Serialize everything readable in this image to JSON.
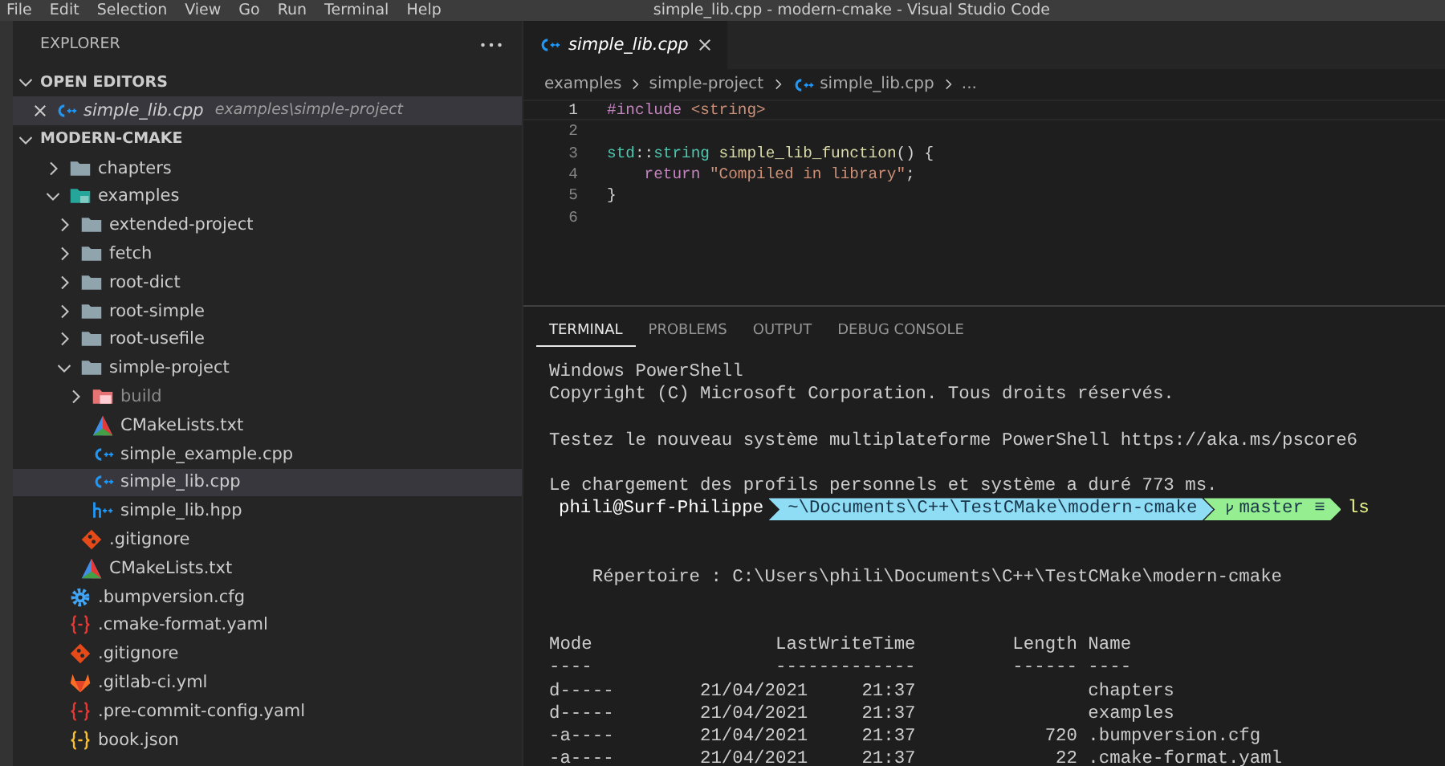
{
  "menu": [
    "File",
    "Edit",
    "Selection",
    "View",
    "Go",
    "Run",
    "Terminal",
    "Help"
  ],
  "window": {
    "title": "simple_lib.cpp - modern-cmake - Visual Studio Code"
  },
  "explorer": {
    "title": "EXPLORER"
  },
  "open_editors": {
    "title": "OPEN EDITORS",
    "expanded": true,
    "items": [
      {
        "name": "simple_lib.cpp",
        "path": "examples\\simple-project",
        "kind": "cpp",
        "selected": true
      }
    ]
  },
  "project": {
    "title": "MODERN-CMAKE",
    "expanded": true,
    "tree": [
      {
        "name": "chapters",
        "kind": "folder",
        "expanded": false,
        "selected": false,
        "dimmed": false
      },
      {
        "name": "examples",
        "kind": "examples",
        "expanded": true,
        "selected": false,
        "dimmed": false,
        "children": [
          {
            "name": "extended-project",
            "kind": "folder",
            "expanded": false,
            "selected": false,
            "dimmed": false
          },
          {
            "name": "fetch",
            "kind": "folder",
            "expanded": false,
            "selected": false,
            "dimmed": false
          },
          {
            "name": "root-dict",
            "kind": "folder",
            "expanded": false,
            "selected": false,
            "dimmed": false
          },
          {
            "name": "root-simple",
            "kind": "folder",
            "expanded": false,
            "selected": false,
            "dimmed": false
          },
          {
            "name": "root-usefile",
            "kind": "folder",
            "expanded": false,
            "selected": false,
            "dimmed": false
          },
          {
            "name": "simple-project",
            "kind": "folder",
            "expanded": true,
            "selected": false,
            "dimmed": false,
            "children": [
              {
                "name": "build",
                "kind": "build",
                "expanded": false,
                "selected": false,
                "dimmed": true
              },
              {
                "name": "CMakeLists.txt",
                "kind": "cmake",
                "selected": false,
                "dimmed": false
              },
              {
                "name": "simple_example.cpp",
                "kind": "cpp",
                "selected": false,
                "dimmed": false
              },
              {
                "name": "simple_lib.cpp",
                "kind": "cpp",
                "selected": true,
                "dimmed": false
              },
              {
                "name": "simple_lib.hpp",
                "kind": "hpp",
                "selected": false,
                "dimmed": false
              }
            ]
          },
          {
            "name": ".gitignore",
            "kind": "git",
            "selected": false,
            "dimmed": false
          },
          {
            "name": "CMakeLists.txt",
            "kind": "cmake",
            "selected": false,
            "dimmed": false
          }
        ]
      },
      {
        "name": ".bumpversion.cfg",
        "kind": "config",
        "selected": false,
        "dimmed": false
      },
      {
        "name": ".cmake-format.yaml",
        "kind": "yaml",
        "selected": false,
        "dimmed": false
      },
      {
        "name": ".gitignore",
        "kind": "git",
        "selected": false,
        "dimmed": false
      },
      {
        "name": ".gitlab-ci.yml",
        "kind": "gitlab",
        "selected": false,
        "dimmed": false
      },
      {
        "name": ".pre-commit-config.yaml",
        "kind": "yaml",
        "selected": false,
        "dimmed": false
      },
      {
        "name": "book.json",
        "kind": "json",
        "selected": false,
        "dimmed": false
      }
    ]
  },
  "editor": {
    "tabs": [
      {
        "name": "simple_lib.cpp",
        "kind": "cpp",
        "selected": true
      }
    ],
    "breadcrumbs": [
      {
        "text": "examples",
        "kind": "folder"
      },
      {
        "text": "simple-project",
        "kind": "folder"
      },
      {
        "text": "simple_lib.cpp",
        "kind": "cpp"
      },
      {
        "text": "...",
        "kind": "symbol"
      }
    ],
    "lines": [
      {
        "number": "1",
        "current": true,
        "tokens": [
          {
            "t": "#include ",
            "kind": "keyword"
          },
          {
            "t": "<string>",
            "kind": "string"
          }
        ]
      },
      {
        "number": "2",
        "current": false
      },
      {
        "number": "3",
        "current": false,
        "tokens": [
          {
            "t": "std",
            "kind": "type"
          },
          {
            "t": "::",
            "kind": "punct"
          },
          {
            "t": "string ",
            "kind": "type"
          },
          {
            "t": "simple_lib_function",
            "kind": "function"
          },
          {
            "t": "() {",
            "kind": "punct"
          }
        ]
      },
      {
        "number": "4",
        "current": false,
        "tokens": [
          {
            "t": "    return ",
            "kind": "keyword"
          },
          {
            "t": "\"Compiled in library\"",
            "kind": "string"
          },
          {
            "t": ";",
            "kind": "punct"
          }
        ]
      },
      {
        "number": "5",
        "current": false,
        "tokens": [
          {
            "t": "}",
            "kind": "punct"
          }
        ]
      },
      {
        "number": "6",
        "current": false
      }
    ]
  },
  "panel": {
    "tabs": [
      {
        "label": "TERMINAL",
        "selected": true
      },
      {
        "label": "PROBLEMS",
        "selected": false
      },
      {
        "label": "OUTPUT",
        "selected": false
      },
      {
        "label": "DEBUG CONSOLE",
        "selected": false
      }
    ],
    "terminal": [
      {
        "kind": "text",
        "text": "Windows PowerShell"
      },
      {
        "kind": "text",
        "text": "Copyright (C) Microsoft Corporation. Tous droits réservés."
      },
      {
        "kind": "blank"
      },
      {
        "kind": "text",
        "text": "Testez le nouveau système multiplateforme PowerShell https://aka.ms/pscore6"
      },
      {
        "kind": "blank"
      },
      {
        "kind": "text",
        "text": "Le chargement des profils personnels et système a duré 773 ms."
      },
      {
        "kind": "prompt",
        "user": "phili@Surf-Philippe",
        "path": "~\\Documents\\C++\\TestCMake\\modern-cmake",
        "branch": "master ≡",
        "command": "ls"
      },
      {
        "kind": "blank"
      },
      {
        "kind": "blank"
      },
      {
        "kind": "text",
        "text": "    Répertoire : C:\\Users\\phili\\Documents\\C++\\TestCMake\\modern-cmake"
      },
      {
        "kind": "blank"
      },
      {
        "kind": "blank"
      },
      {
        "kind": "text",
        "text": "Mode                 LastWriteTime         Length Name"
      },
      {
        "kind": "text",
        "text": "----                 -------------         ------ ----"
      },
      {
        "kind": "text",
        "text": "d-----        21/04/2021     21:37                chapters"
      },
      {
        "kind": "text",
        "text": "d-----        21/04/2021     21:37                examples"
      },
      {
        "kind": "text",
        "text": "-a----        21/04/2021     21:37            720 .bumpversion.cfg"
      },
      {
        "kind": "text",
        "text": "-a----        21/04/2021     21:37             22 .cmake-format.yaml"
      }
    ]
  }
}
